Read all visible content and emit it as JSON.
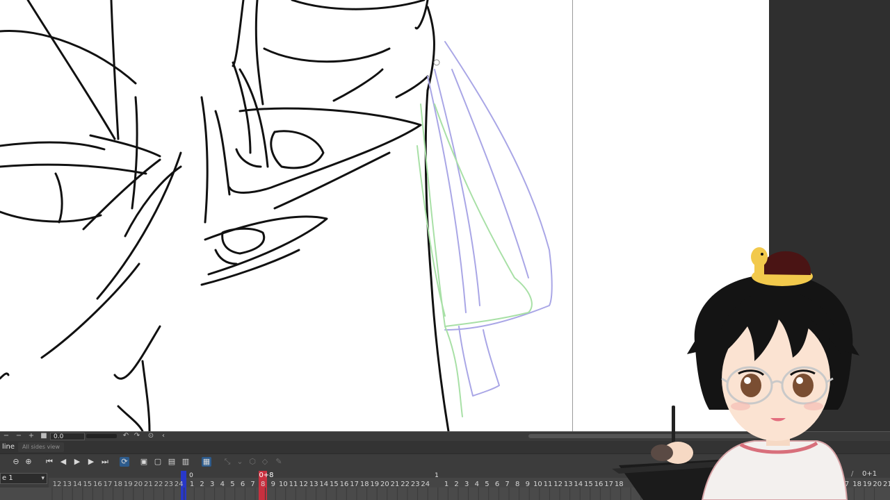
{
  "canvas": {
    "background": "#ffffff",
    "zoom_value": "0.0"
  },
  "timeline": {
    "tab_label": "line",
    "tab_allsides": "All sides view",
    "selected_timeline": "e 1",
    "frame_counter": "0+1",
    "slash": "/",
    "playhead_label": "0+8",
    "start_marker": "0",
    "section_marker": "1",
    "ruler_numbers_left": [
      "12",
      "13",
      "14",
      "15",
      "16",
      "17",
      "18",
      "19",
      "20",
      "21",
      "22",
      "23",
      "24"
    ],
    "ruler_numbers_mid": [
      "1",
      "2",
      "3",
      "4",
      "5",
      "6",
      "7",
      "8",
      "9",
      "10",
      "11",
      "12",
      "13",
      "14",
      "15",
      "16",
      "17",
      "18",
      "19",
      "20",
      "21",
      "22",
      "23",
      "24"
    ],
    "ruler_numbers_right": [
      "1",
      "2",
      "3",
      "4",
      "5",
      "6",
      "7",
      "8",
      "9",
      "10",
      "11",
      "12",
      "13",
      "14",
      "15",
      "16",
      "17",
      "18"
    ],
    "ruler_numbers_far_right": [
      "7",
      "18",
      "19",
      "20",
      "21"
    ]
  },
  "toolbar": {
    "icons": [
      "zoom-out-icon",
      "zoom-in-icon",
      "first-frame-icon",
      "prev-frame-icon",
      "play-icon",
      "next-frame-icon",
      "last-frame-icon",
      "loop-icon",
      "new-cel-icon",
      "onion-skin-icon",
      "cel-settings-icon",
      "copy-cel-icon",
      "light-table-icon",
      "specify-cel-icon",
      "dropdown-icon",
      "camera-icon",
      "keyframe-icon",
      "pen-icon"
    ]
  },
  "colors": {
    "accent_active": "#2d5b8c",
    "playhead": "#c8303f",
    "range_marker": "#2838c8",
    "onion_blue": "#a9a6e6",
    "onion_green": "#a8e0a6",
    "line_art": "#111111",
    "panel_dark": "#2f2f2f"
  }
}
